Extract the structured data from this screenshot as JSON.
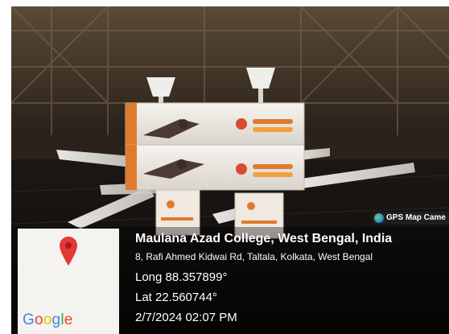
{
  "gps_tag": {
    "label": "GPS Map Came",
    "icon": "globe-icon"
  },
  "map": {
    "pin_icon": "location-pin-icon",
    "pin_color": "#e53935",
    "logo_letters": [
      "G",
      "o",
      "o",
      "g",
      "l",
      "e"
    ]
  },
  "location": {
    "title": "Maulana Azad College, West Bengal, India",
    "address": "8, Rafi Ahmed Kidwai Rd, Taltala, Kolkata, West Bengal",
    "longitude": "Long 88.357899°",
    "latitude": "Lat 22.560744°",
    "datetime": "2/7/2024 02:07 PM"
  }
}
